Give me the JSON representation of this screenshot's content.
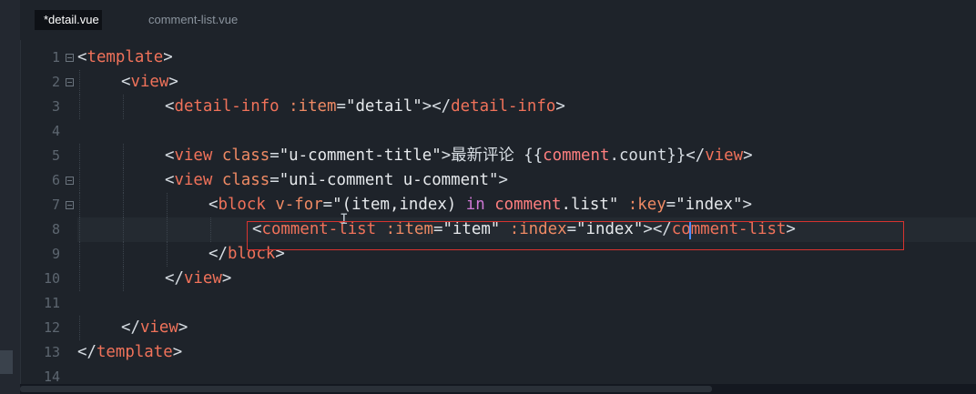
{
  "tabs": [
    {
      "label": "*detail.vue",
      "active": true
    },
    {
      "label": "comment-list.vue",
      "active": false
    }
  ],
  "editor": {
    "lines": [
      {
        "n": "1",
        "fold": true,
        "indent": 0,
        "tokens": [
          {
            "t": "<",
            "c": "punc"
          },
          {
            "t": "template",
            "c": "tag"
          },
          {
            "t": ">",
            "c": "punc"
          }
        ]
      },
      {
        "n": "2",
        "fold": true,
        "indent": 1,
        "tokens": [
          {
            "t": "<",
            "c": "punc"
          },
          {
            "t": "view",
            "c": "tag"
          },
          {
            "t": ">",
            "c": "punc"
          }
        ]
      },
      {
        "n": "3",
        "fold": false,
        "indent": 2,
        "tokens": [
          {
            "t": "<",
            "c": "punc"
          },
          {
            "t": "detail-info",
            "c": "tag"
          },
          {
            "t": " :item",
            "c": "attr"
          },
          {
            "t": "=",
            "c": "punc"
          },
          {
            "t": "\"detail\"",
            "c": "str"
          },
          {
            "t": "></",
            "c": "punc"
          },
          {
            "t": "detail-info",
            "c": "tag"
          },
          {
            "t": ">",
            "c": "punc"
          }
        ]
      },
      {
        "n": "4",
        "fold": false,
        "indent": 0,
        "tokens": []
      },
      {
        "n": "5",
        "fold": false,
        "indent": 2,
        "tokens": [
          {
            "t": "<",
            "c": "punc"
          },
          {
            "t": "view",
            "c": "tag"
          },
          {
            "t": " class",
            "c": "attr"
          },
          {
            "t": "=",
            "c": "punc"
          },
          {
            "t": "\"u-comment-title\"",
            "c": "str"
          },
          {
            "t": ">",
            "c": "punc"
          },
          {
            "t": "最新评论",
            "c": "ch"
          },
          {
            "t": " {{",
            "c": "punc"
          },
          {
            "t": "comment",
            "c": "name"
          },
          {
            "t": ".count}}",
            "c": "punc"
          },
          {
            "t": "</",
            "c": "punc"
          },
          {
            "t": "view",
            "c": "tag"
          },
          {
            "t": ">",
            "c": "punc"
          }
        ]
      },
      {
        "n": "6",
        "fold": true,
        "indent": 2,
        "tokens": [
          {
            "t": "<",
            "c": "punc"
          },
          {
            "t": "view",
            "c": "tag"
          },
          {
            "t": " class",
            "c": "attr"
          },
          {
            "t": "=",
            "c": "punc"
          },
          {
            "t": "\"uni-comment u-comment\"",
            "c": "str"
          },
          {
            "t": ">",
            "c": "punc"
          }
        ]
      },
      {
        "n": "7",
        "fold": true,
        "indent": 3,
        "tokens": [
          {
            "t": "<",
            "c": "punc"
          },
          {
            "t": "block",
            "c": "tag"
          },
          {
            "t": " v-for",
            "c": "attr"
          },
          {
            "t": "=",
            "c": "punc"
          },
          {
            "t": "\"(item,index) ",
            "c": "str"
          },
          {
            "t": "in",
            "c": "kw"
          },
          {
            "t": " ",
            "c": "str"
          },
          {
            "t": "comment",
            "c": "name"
          },
          {
            "t": ".list\"",
            "c": "str"
          },
          {
            "t": " :key",
            "c": "attr"
          },
          {
            "t": "=",
            "c": "punc"
          },
          {
            "t": "\"index\"",
            "c": "str"
          },
          {
            "t": ">",
            "c": "punc"
          }
        ]
      },
      {
        "n": "8",
        "fold": false,
        "indent": 4,
        "tokens": [
          {
            "t": "<",
            "c": "punc"
          },
          {
            "t": "comment-list",
            "c": "tag"
          },
          {
            "t": " :item",
            "c": "attr"
          },
          {
            "t": "=",
            "c": "punc"
          },
          {
            "t": "\"item\"",
            "c": "str"
          },
          {
            "t": " :index",
            "c": "attr"
          },
          {
            "t": "=",
            "c": "punc"
          },
          {
            "t": "\"index\"",
            "c": "str"
          },
          {
            "t": "></",
            "c": "punc"
          },
          {
            "t": "comment-list",
            "c": "tag"
          },
          {
            "t": ">",
            "c": "punc"
          }
        ]
      },
      {
        "n": "9",
        "fold": false,
        "indent": 3,
        "tokens": [
          {
            "t": "</",
            "c": "punc"
          },
          {
            "t": "block",
            "c": "tag"
          },
          {
            "t": ">",
            "c": "punc"
          }
        ]
      },
      {
        "n": "10",
        "fold": false,
        "indent": 2,
        "tokens": [
          {
            "t": "</",
            "c": "punc"
          },
          {
            "t": "view",
            "c": "tag"
          },
          {
            "t": ">",
            "c": "punc"
          }
        ]
      },
      {
        "n": "11",
        "fold": false,
        "indent": 0,
        "tokens": []
      },
      {
        "n": "12",
        "fold": false,
        "indent": 1,
        "tokens": [
          {
            "t": "</",
            "c": "punc"
          },
          {
            "t": "view",
            "c": "tag"
          },
          {
            "t": ">",
            "c": "punc"
          }
        ]
      },
      {
        "n": "13",
        "fold": false,
        "indent": 0,
        "tokens": [
          {
            "t": "</",
            "c": "punc"
          },
          {
            "t": "template",
            "c": "tag"
          },
          {
            "t": ">",
            "c": "punc"
          }
        ]
      },
      {
        "n": "14",
        "fold": false,
        "indent": 0,
        "tokens": []
      }
    ],
    "current_line": "8"
  },
  "colors": {
    "background": "#1e232a",
    "tag": "#f0725a",
    "attribute": "#ee8a64",
    "string": "#e6e9ec",
    "keyword": "#cf78d6",
    "variable": "#ff7f7f",
    "annotation_box": "#d6332f",
    "caret": "#4a8cff"
  }
}
